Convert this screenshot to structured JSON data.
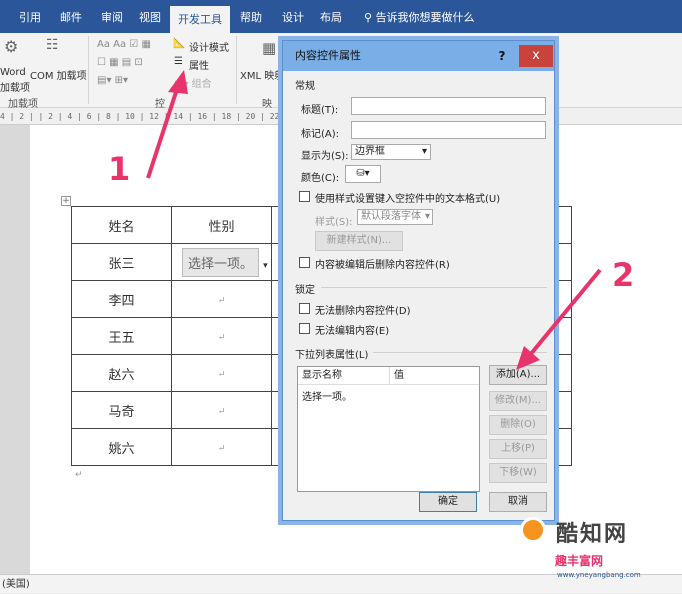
{
  "ribbon": {
    "tabs": [
      "引用",
      "邮件",
      "审阅",
      "视图",
      "开发工具",
      "帮助",
      "设计",
      "布局"
    ],
    "active_tab": "开发工具",
    "tell_me": "告诉我你想要做什么",
    "items": {
      "word": "Word",
      "com_addins": "COM 加载项",
      "addins": "加载项",
      "addins_group": "加载项",
      "design_mode": "设计模式",
      "properties": "属性",
      "group": "组合",
      "controls_group": "控",
      "xml_mapping": "XML 映射",
      "mapping_group": "映"
    }
  },
  "ruler": "4 | 2 |  | 2 | 4 | 6 | 8 | 10 | 12 | 14 | 16 | 18 | 20 | 22 | 24 | 26 | 28 | 30 | 32 | 34 | 36 | 38 | 40",
  "document": {
    "table": {
      "headers": [
        "姓名",
        "性别"
      ],
      "rows": [
        "张三",
        "李四",
        "王五",
        "赵六",
        "马奇",
        "姚六"
      ],
      "placeholder": "选择一项。"
    }
  },
  "statusbar": {
    "language": "(美国)"
  },
  "dialog": {
    "title": "内容控件属性",
    "help": "?",
    "close": "x",
    "general": "常规",
    "title_label": "标题(T):",
    "tag_label": "标记(A):",
    "show_as_label": "显示为(S):",
    "show_as_value": "边界框",
    "color_label": "颜色(C):",
    "use_style": "使用样式设置键入空控件中的文本格式(U)",
    "style_label": "样式(S):",
    "style_value": "默认段落字体",
    "new_style": "新建样式(N)...",
    "remove_when_edited": "内容被编辑后删除内容控件(R)",
    "locking": "锁定",
    "cannot_delete": "无法删除内容控件(D)",
    "cannot_edit": "无法编辑内容(E)",
    "dropdown_props": "下拉列表属性(L)",
    "col_display": "显示名称",
    "col_value": "值",
    "list_item": "选择一项。",
    "add": "添加(A)...",
    "modify": "修改(M)...",
    "delete": "删除(O)",
    "move_up": "上移(P)",
    "move_down": "下移(W)",
    "ok": "确定",
    "cancel": "取消"
  },
  "annotations": {
    "step1": "1",
    "step2": "2"
  },
  "watermark": {
    "text": "酷知网",
    "sub": "趣丰富网",
    "url": "www.yneyangbang.com"
  },
  "colors": {
    "ribbon": "#2b579a",
    "arrow": "#e8336b",
    "close": "#c7433c",
    "titlebar": "#7aaee6"
  }
}
